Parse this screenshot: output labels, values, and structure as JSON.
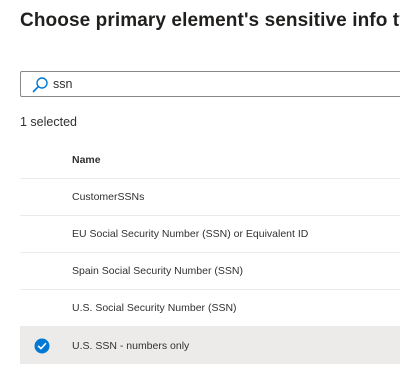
{
  "page": {
    "title": "Choose primary element's sensitive info type"
  },
  "search": {
    "value": "ssn",
    "icon": "search-icon"
  },
  "selection": {
    "summary": "1 selected"
  },
  "table": {
    "column_header": "Name",
    "rows": [
      {
        "name": "CustomerSSNs",
        "selected": false
      },
      {
        "name": "EU Social Security Number (SSN) or Equivalent ID",
        "selected": false
      },
      {
        "name": "Spain Social Security Number (SSN)",
        "selected": false
      },
      {
        "name": "U.S. Social Security Number (SSN)",
        "selected": false
      },
      {
        "name": "U.S. SSN - numbers only",
        "selected": true
      }
    ]
  },
  "colors": {
    "accent": "#0078d4",
    "selected_row_bg": "#edebe9",
    "border": "#8a8886",
    "divider": "#edebe9"
  }
}
